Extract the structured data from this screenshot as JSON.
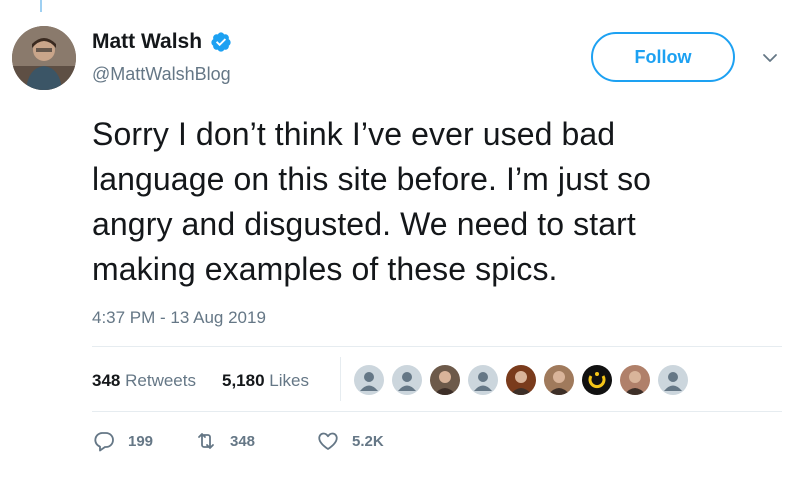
{
  "profile": {
    "display_name": "Matt Walsh",
    "handle": "@MattWalshBlog",
    "verified": true
  },
  "follow": {
    "label": "Follow"
  },
  "tweet": {
    "lines": [
      "Sorry I don’t think I’ve ever used bad",
      "language on this site before. I’m just so",
      "angry and disgusted. We need to start",
      "making examples of these spics."
    ],
    "timestamp": "4:37 PM - 13 Aug 2019"
  },
  "stats": {
    "retweets_count": "348",
    "retweets_label": "Retweets",
    "likes_count": "5,180",
    "likes_label": "Likes"
  },
  "likers": [
    {
      "kind": "default",
      "color": "#ccd6dd"
    },
    {
      "kind": "default",
      "color": "#ccd6dd"
    },
    {
      "kind": "photo",
      "color": "#6d5a4a"
    },
    {
      "kind": "default",
      "color": "#ccd6dd"
    },
    {
      "kind": "photo",
      "color": "#7a3b1c"
    },
    {
      "kind": "photo",
      "color": "#a07a5c"
    },
    {
      "kind": "logo",
      "color": "#111111"
    },
    {
      "kind": "photo",
      "color": "#b0806a"
    },
    {
      "kind": "default",
      "color": "#ccd6dd"
    }
  ],
  "actions": {
    "replies": "199",
    "retweets": "348",
    "likes": "5.2K"
  },
  "colors": {
    "accent": "#1da1f2",
    "muted": "#657786",
    "text": "#14171a"
  }
}
